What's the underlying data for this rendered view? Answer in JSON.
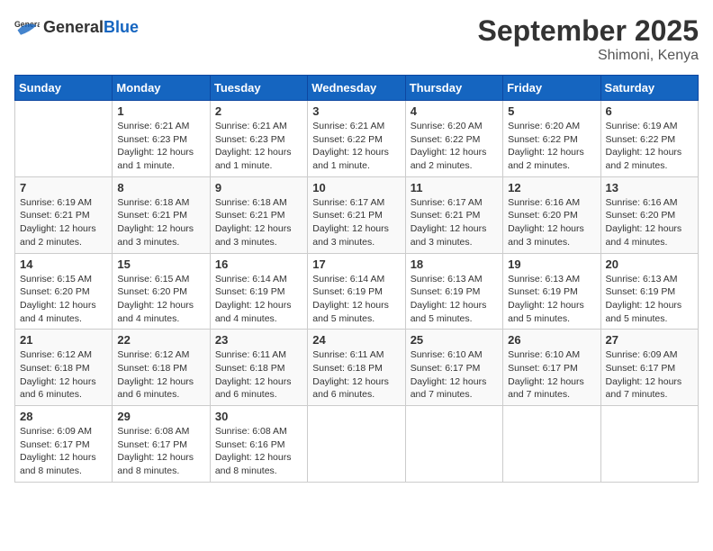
{
  "header": {
    "logo_general": "General",
    "logo_blue": "Blue",
    "month": "September 2025",
    "location": "Shimoni, Kenya"
  },
  "weekdays": [
    "Sunday",
    "Monday",
    "Tuesday",
    "Wednesday",
    "Thursday",
    "Friday",
    "Saturday"
  ],
  "weeks": [
    [
      {
        "day": "",
        "info": ""
      },
      {
        "day": "1",
        "info": "Sunrise: 6:21 AM\nSunset: 6:23 PM\nDaylight: 12 hours\nand 1 minute."
      },
      {
        "day": "2",
        "info": "Sunrise: 6:21 AM\nSunset: 6:23 PM\nDaylight: 12 hours\nand 1 minute."
      },
      {
        "day": "3",
        "info": "Sunrise: 6:21 AM\nSunset: 6:22 PM\nDaylight: 12 hours\nand 1 minute."
      },
      {
        "day": "4",
        "info": "Sunrise: 6:20 AM\nSunset: 6:22 PM\nDaylight: 12 hours\nand 2 minutes."
      },
      {
        "day": "5",
        "info": "Sunrise: 6:20 AM\nSunset: 6:22 PM\nDaylight: 12 hours\nand 2 minutes."
      },
      {
        "day": "6",
        "info": "Sunrise: 6:19 AM\nSunset: 6:22 PM\nDaylight: 12 hours\nand 2 minutes."
      }
    ],
    [
      {
        "day": "7",
        "info": "Sunrise: 6:19 AM\nSunset: 6:21 PM\nDaylight: 12 hours\nand 2 minutes."
      },
      {
        "day": "8",
        "info": "Sunrise: 6:18 AM\nSunset: 6:21 PM\nDaylight: 12 hours\nand 3 minutes."
      },
      {
        "day": "9",
        "info": "Sunrise: 6:18 AM\nSunset: 6:21 PM\nDaylight: 12 hours\nand 3 minutes."
      },
      {
        "day": "10",
        "info": "Sunrise: 6:17 AM\nSunset: 6:21 PM\nDaylight: 12 hours\nand 3 minutes."
      },
      {
        "day": "11",
        "info": "Sunrise: 6:17 AM\nSunset: 6:21 PM\nDaylight: 12 hours\nand 3 minutes."
      },
      {
        "day": "12",
        "info": "Sunrise: 6:16 AM\nSunset: 6:20 PM\nDaylight: 12 hours\nand 3 minutes."
      },
      {
        "day": "13",
        "info": "Sunrise: 6:16 AM\nSunset: 6:20 PM\nDaylight: 12 hours\nand 4 minutes."
      }
    ],
    [
      {
        "day": "14",
        "info": "Sunrise: 6:15 AM\nSunset: 6:20 PM\nDaylight: 12 hours\nand 4 minutes."
      },
      {
        "day": "15",
        "info": "Sunrise: 6:15 AM\nSunset: 6:20 PM\nDaylight: 12 hours\nand 4 minutes."
      },
      {
        "day": "16",
        "info": "Sunrise: 6:14 AM\nSunset: 6:19 PM\nDaylight: 12 hours\nand 4 minutes."
      },
      {
        "day": "17",
        "info": "Sunrise: 6:14 AM\nSunset: 6:19 PM\nDaylight: 12 hours\nand 5 minutes."
      },
      {
        "day": "18",
        "info": "Sunrise: 6:13 AM\nSunset: 6:19 PM\nDaylight: 12 hours\nand 5 minutes."
      },
      {
        "day": "19",
        "info": "Sunrise: 6:13 AM\nSunset: 6:19 PM\nDaylight: 12 hours\nand 5 minutes."
      },
      {
        "day": "20",
        "info": "Sunrise: 6:13 AM\nSunset: 6:19 PM\nDaylight: 12 hours\nand 5 minutes."
      }
    ],
    [
      {
        "day": "21",
        "info": "Sunrise: 6:12 AM\nSunset: 6:18 PM\nDaylight: 12 hours\nand 6 minutes."
      },
      {
        "day": "22",
        "info": "Sunrise: 6:12 AM\nSunset: 6:18 PM\nDaylight: 12 hours\nand 6 minutes."
      },
      {
        "day": "23",
        "info": "Sunrise: 6:11 AM\nSunset: 6:18 PM\nDaylight: 12 hours\nand 6 minutes."
      },
      {
        "day": "24",
        "info": "Sunrise: 6:11 AM\nSunset: 6:18 PM\nDaylight: 12 hours\nand 6 minutes."
      },
      {
        "day": "25",
        "info": "Sunrise: 6:10 AM\nSunset: 6:17 PM\nDaylight: 12 hours\nand 7 minutes."
      },
      {
        "day": "26",
        "info": "Sunrise: 6:10 AM\nSunset: 6:17 PM\nDaylight: 12 hours\nand 7 minutes."
      },
      {
        "day": "27",
        "info": "Sunrise: 6:09 AM\nSunset: 6:17 PM\nDaylight: 12 hours\nand 7 minutes."
      }
    ],
    [
      {
        "day": "28",
        "info": "Sunrise: 6:09 AM\nSunset: 6:17 PM\nDaylight: 12 hours\nand 8 minutes."
      },
      {
        "day": "29",
        "info": "Sunrise: 6:08 AM\nSunset: 6:17 PM\nDaylight: 12 hours\nand 8 minutes."
      },
      {
        "day": "30",
        "info": "Sunrise: 6:08 AM\nSunset: 6:16 PM\nDaylight: 12 hours\nand 8 minutes."
      },
      {
        "day": "",
        "info": ""
      },
      {
        "day": "",
        "info": ""
      },
      {
        "day": "",
        "info": ""
      },
      {
        "day": "",
        "info": ""
      }
    ]
  ]
}
